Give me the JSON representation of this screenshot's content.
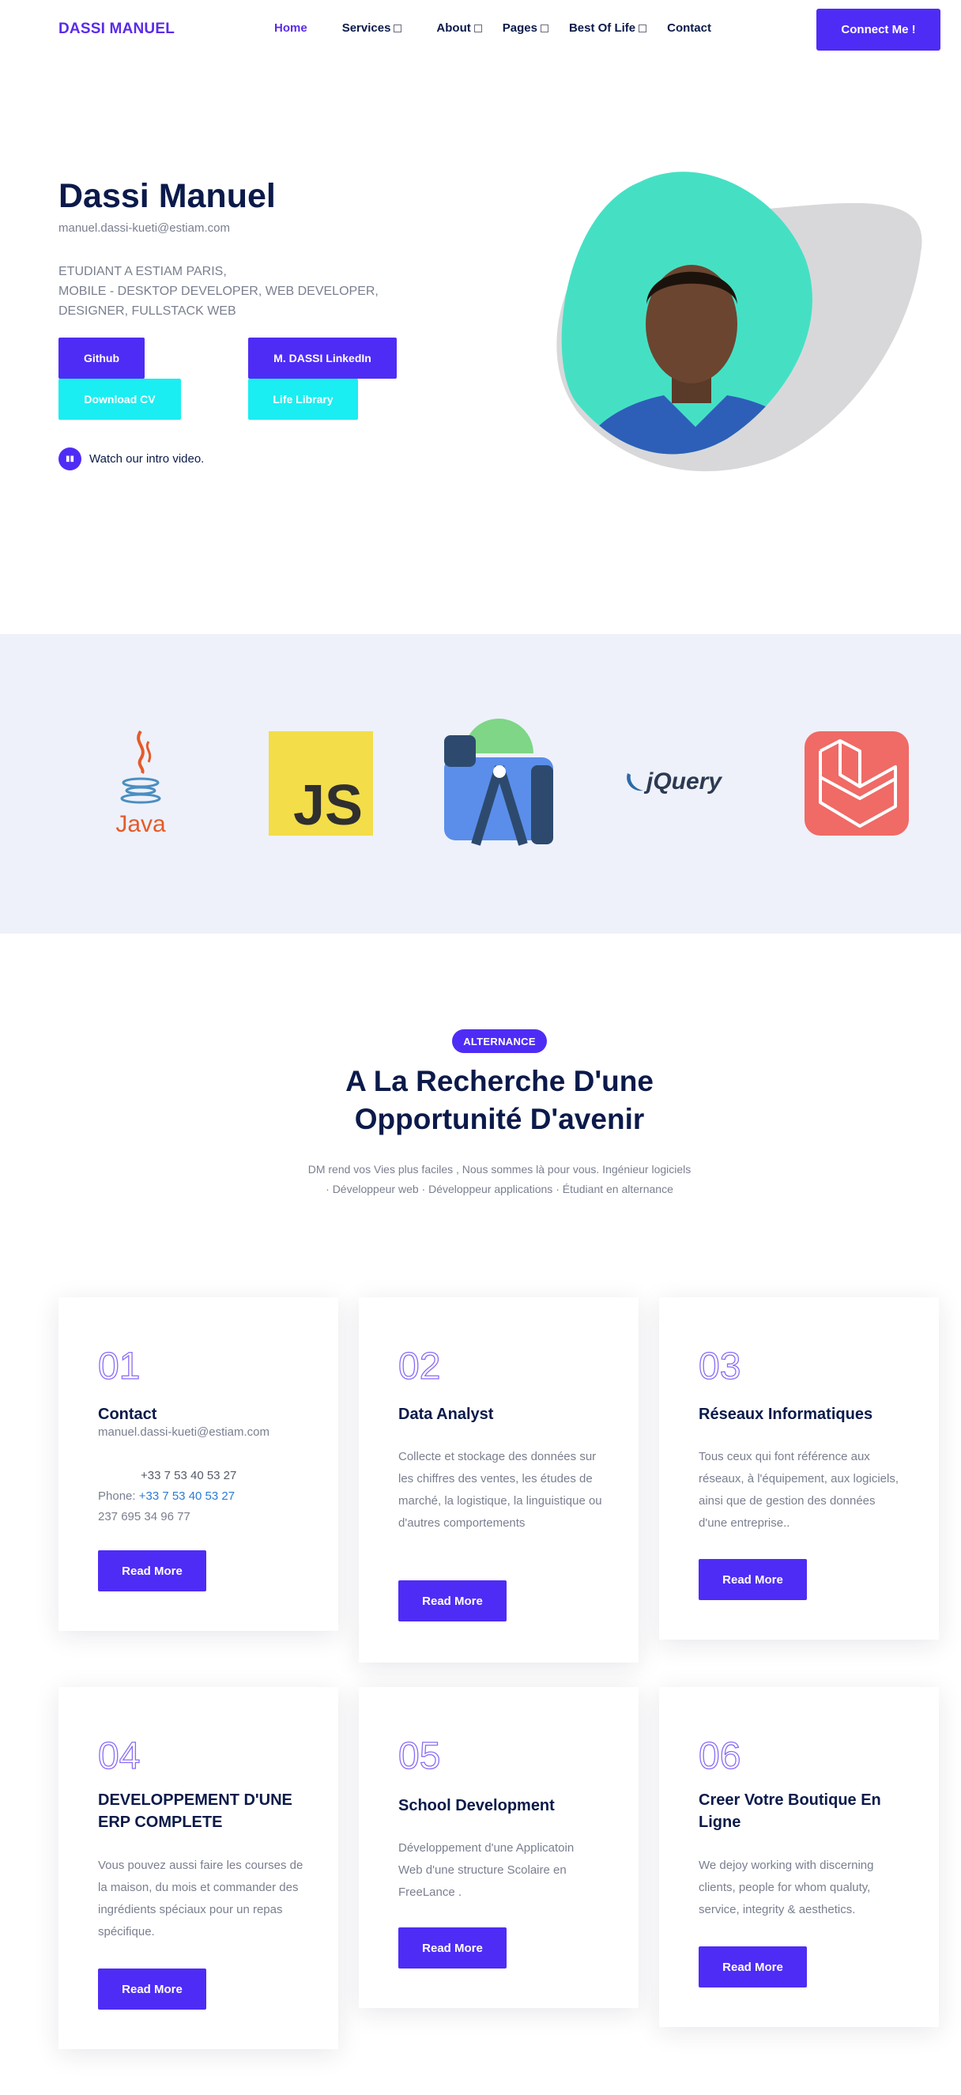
{
  "nav": {
    "brand": "DASSI MANUEL",
    "items": [
      {
        "label": "Home",
        "active": true,
        "caret": false
      },
      {
        "label": "Services",
        "active": false,
        "caret": true
      },
      {
        "label": "About",
        "active": false,
        "caret": true
      },
      {
        "label": "Pages",
        "active": false,
        "caret": true
      },
      {
        "label": "Best Of Life",
        "active": false,
        "caret": true
      },
      {
        "label": "Contact",
        "active": false,
        "caret": false
      }
    ],
    "cta": "Connect Me !"
  },
  "hero": {
    "name": "Dassi Manuel",
    "email": "manuel.dassi-kueti@estiam.com",
    "desc_line1": "ETUDIANT A ESTIAM PARIS,",
    "desc_line2": "MOBILE - DESKTOP DEVELOPER, WEB DEVELOPER, DESIGNER, FULLSTACK WEB",
    "btn_github": "Github",
    "btn_linkedin": "M. DASSI LinkedIn",
    "btn_cv": "Download CV",
    "btn_library": "Life Library",
    "video_text": "Watch our intro video."
  },
  "logos": {
    "java": "Java",
    "js": "JS",
    "jquery": "jQuery"
  },
  "section": {
    "badge": "ALTERNANCE",
    "title_line1": "A La Recherche D'une",
    "title_line2": "Opportunité D'avenir",
    "subtitle": "DM rend vos Vies plus faciles , Nous sommes là pour vous. Ingénieur logiciels · Développeur web · Développeur applications · Étudiant en alternance"
  },
  "cards": [
    {
      "num": "01",
      "title": "Contact",
      "email": "manuel.dassi-kueti@estiam.com",
      "phone_top": "+33 7 53 40 53 27",
      "phone_label": "Phone: ",
      "phone_link": "+33 7 53 40 53 27",
      "phone_alt": "237 695 34 96 77",
      "btn": "Read More"
    },
    {
      "num": "02",
      "title": "Data Analyst",
      "text": "Collecte et stockage des données sur les chiffres des ventes, les études de marché, la logistique, la linguistique ou d'autres comportements",
      "btn": "Read More"
    },
    {
      "num": "03",
      "title": "Réseaux Informatiques",
      "text": "Tous ceux qui font référence aux réseaux, à l'équipement, aux logiciels, ainsi que de gestion des données d'une entreprise..",
      "btn": "Read More"
    },
    {
      "num": "04",
      "title": "DEVELOPPEMENT D'UNE ERP COMPLETE",
      "text": "Vous pouvez aussi faire les courses de la maison, du mois et commander des ingrédients spéciaux pour un repas spécifique.",
      "btn": "Read More"
    },
    {
      "num": "05",
      "title": "School Development",
      "text": "Développement d'une Applicatoin Web d'une structure Scolaire en FreeLance .",
      "btn": "Read More"
    },
    {
      "num": "06",
      "title": "Creer Votre Boutique En Ligne",
      "text": "We dejoy working with discerning clients, people for whom qualuty, service, integrity & aesthetics.",
      "btn": "Read More"
    }
  ],
  "colors": {
    "accent": "#4f2cf5",
    "cyan": "#1aeef2",
    "blob": "#45e0c4",
    "band": "#eef1fa"
  }
}
